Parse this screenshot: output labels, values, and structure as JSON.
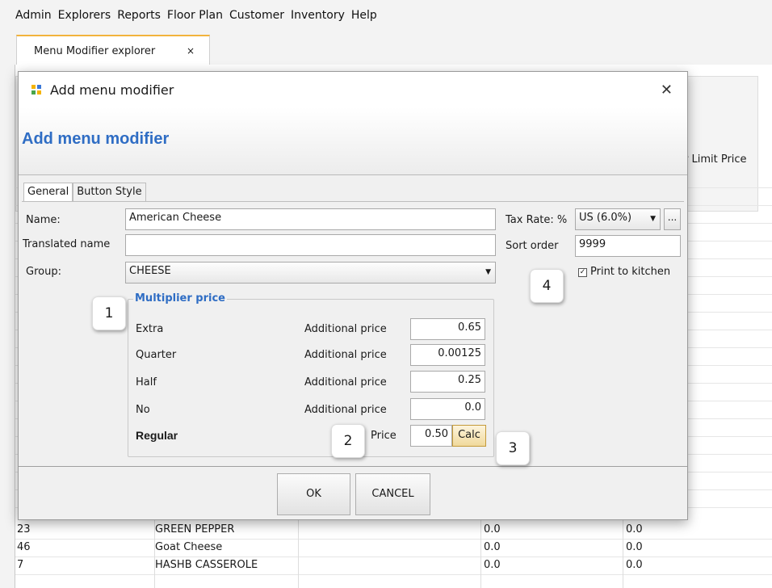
{
  "menubar": {
    "items": [
      "Admin",
      "Explorers",
      "Reports",
      "Floor Plan",
      "Customer",
      "Inventory",
      "Help"
    ]
  },
  "explorer_tab": {
    "label": "Menu Modifier explorer",
    "close": "×"
  },
  "background_table": {
    "partial_header": "er Limit Price",
    "rows": [
      {
        "id": "23",
        "name": "GREEN PEPPER",
        "price": "0.0",
        "limit": "0.0"
      },
      {
        "id": "46",
        "name": "Goat Cheese",
        "price": "0.0",
        "limit": "0.0"
      },
      {
        "id": "7",
        "name": "HASHB CASSEROLE",
        "price": "0.0",
        "limit": "0.0"
      }
    ]
  },
  "dialog": {
    "window_title": "Add menu modifier",
    "close_glyph": "✕",
    "header_title": "Add menu modifier",
    "tabs": [
      "General",
      "Button Style"
    ],
    "name_label": "Name:",
    "name_value": "American Cheese",
    "translated_label": "Translated name",
    "translated_value": "",
    "group_label": "Group:",
    "group_value": "CHEESE",
    "tax_label": "Tax Rate: %",
    "tax_value": "US (6.0%)",
    "tax_more": "...",
    "sort_label": "Sort order",
    "sort_value": "9999",
    "print_label": "Print to kitchen",
    "print_checked": true,
    "multiplier": {
      "title": "Multiplier price",
      "rows": [
        {
          "name": "Extra",
          "label": "Additional price",
          "value": "0.65"
        },
        {
          "name": "Quarter",
          "label": "Additional price",
          "value": "0.00125"
        },
        {
          "name": "Half",
          "label": "Additional price",
          "value": "0.25"
        },
        {
          "name": "No",
          "label": "Additional price",
          "value": "0.0"
        }
      ],
      "regular_name": "Regular",
      "regular_label": "Price",
      "regular_value": "0.50",
      "calc_label": "Calc"
    },
    "ok_label": "OK",
    "cancel_label": "CANCEL"
  },
  "callouts": [
    "1",
    "2",
    "3",
    "4"
  ],
  "colors": {
    "accent_blue": "#2f6dc4",
    "tab_accent": "#f2b33d",
    "icon_yellow": "#f5b400",
    "icon_blue": "#3b78d8",
    "icon_green": "#49a54a"
  }
}
